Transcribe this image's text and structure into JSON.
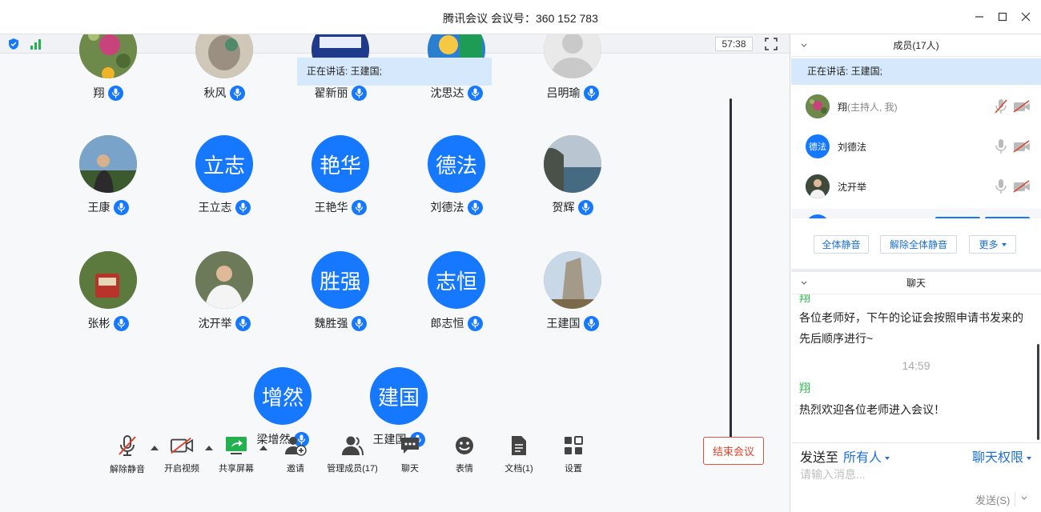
{
  "window": {
    "title": "腾讯会议  会议号：360 152 783"
  },
  "status": {
    "timer": "57:38"
  },
  "speaking_banner": "正在讲话: 王建国;",
  "tiles": [
    {
      "name": "翔",
      "avatar_text": "",
      "photo": "flower"
    },
    {
      "name": "秋风",
      "avatar_text": "",
      "photo": "cat"
    },
    {
      "name": "翟新丽",
      "avatar_text": "",
      "photo": "blue"
    },
    {
      "name": "沈思达",
      "avatar_text": "",
      "photo": "cartoon"
    },
    {
      "name": "吕明瑜",
      "avatar_text": "",
      "photo": "default"
    },
    {
      "name": "王康",
      "avatar_text": "",
      "photo": "person"
    },
    {
      "name": "王立志",
      "avatar_text": "立志",
      "photo": ""
    },
    {
      "name": "王艳华",
      "avatar_text": "艳华",
      "photo": ""
    },
    {
      "name": "刘德法",
      "avatar_text": "德法",
      "photo": ""
    },
    {
      "name": "贺辉",
      "avatar_text": "",
      "photo": "sea"
    },
    {
      "name": "张彬",
      "avatar_text": "",
      "photo": "tram"
    },
    {
      "name": "沈开举",
      "avatar_text": "",
      "photo": "man"
    },
    {
      "name": "魏胜强",
      "avatar_text": "胜强",
      "photo": ""
    },
    {
      "name": "郎志恒",
      "avatar_text": "志恒",
      "photo": ""
    },
    {
      "name": "王建国",
      "avatar_text": "",
      "photo": "rock"
    },
    {
      "name": "梁增然",
      "avatar_text": "增然",
      "photo": ""
    },
    {
      "name": "王建国",
      "avatar_text": "建国",
      "photo": ""
    }
  ],
  "toolbar": {
    "unmute": "解除静音",
    "video": "开启视频",
    "share": "共享屏幕",
    "invite": "邀请",
    "manage": "管理成员(17)",
    "chat": "聊天",
    "emoji": "表情",
    "docs": "文档(1)",
    "settings": "设置",
    "end": "结束会议"
  },
  "members": {
    "header": "成员(17人)",
    "speaking": "正在讲话:  王建国;",
    "list": [
      {
        "name": "翔",
        "role": "(主持人, 我)",
        "avatar_text": "",
        "mic_muted": true,
        "cam_off": true
      },
      {
        "name": "刘德法",
        "role": "",
        "avatar_text": "德法",
        "mic_muted": false,
        "cam_off": true
      },
      {
        "name": "沈开举",
        "role": "",
        "avatar_text": "",
        "mic_muted": false,
        "cam_off": true
      }
    ],
    "mute_all": "全体静音",
    "unmute_all": "解除全体静音",
    "more": "更多"
  },
  "chat": {
    "header": "聊天",
    "messages": [
      {
        "sender": "翔",
        "text": "各位老师好，下午的论证会按照申请书发来的先后顺序进行~"
      },
      {
        "sender": "翔",
        "text": "热烈欢迎各位老师进入会议！"
      }
    ],
    "time": "14:59",
    "send_to_label": "发送至",
    "send_to_value": "所有人",
    "permission": "聊天权限",
    "input_placeholder": "请输入消息...",
    "send_label": "发送(S)"
  },
  "colors": {
    "accent": "#1677ff",
    "banner": "#d6e8fb",
    "end": "#e0402a",
    "sender": "#2eb84f"
  }
}
